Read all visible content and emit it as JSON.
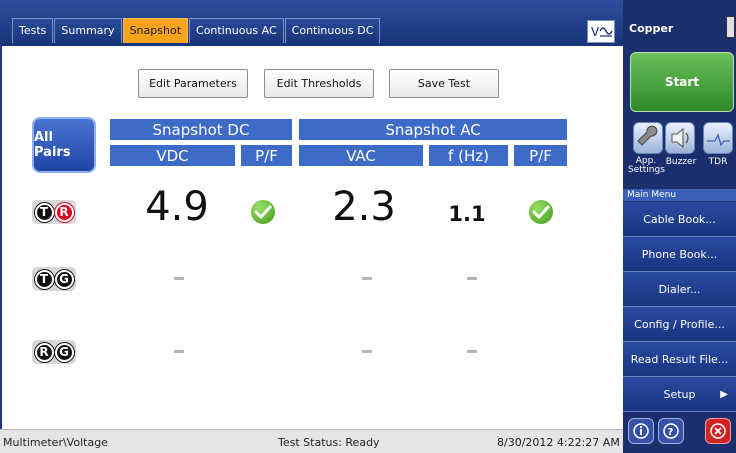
{
  "tabs": [
    {
      "label": "Tests"
    },
    {
      "label": "Summary"
    },
    {
      "label": "Snapshot",
      "active": true
    },
    {
      "label": "Continuous AC"
    },
    {
      "label": "Continuous DC"
    }
  ],
  "toolbar": {
    "edit_parameters": "Edit Parameters",
    "edit_thresholds": "Edit Thresholds",
    "save_test": "Save Test"
  },
  "all_pairs_label": "All Pairs",
  "headers": {
    "snapshot_dc": "Snapshot DC",
    "snapshot_ac": "Snapshot AC",
    "vdc": "VDC",
    "pf_dc": "P/F",
    "vac": "VAC",
    "fhz": "f (Hz)",
    "pf_ac": "P/F"
  },
  "rows": [
    {
      "pair": [
        "T",
        "R"
      ],
      "vdc": "4.9",
      "vac": "2.3",
      "fhz": "1.1",
      "dc_pass": true,
      "ac_pass": true
    },
    {
      "pair": [
        "T",
        "G"
      ],
      "vdc": "–",
      "vac": "–",
      "fhz": "–"
    },
    {
      "pair": [
        "R",
        "G"
      ],
      "vdc": "–",
      "vac": "–",
      "fhz": "–"
    }
  ],
  "status": {
    "path": "Multimeter\\Voltage",
    "test_status": "Test Status: Ready",
    "datetime": "8/30/2012 4:22:27 AM"
  },
  "side": {
    "title": "Copper",
    "start": "Start",
    "tools": [
      {
        "label": "App. Settings",
        "icon": "wrench-icon"
      },
      {
        "label": "Buzzer",
        "icon": "speaker-icon"
      },
      {
        "label": "TDR",
        "icon": "tdr-icon"
      }
    ],
    "main_menu_title": "Main Menu",
    "menu": [
      {
        "label": "Cable Book..."
      },
      {
        "label": "Phone Book..."
      },
      {
        "label": "Dialer..."
      },
      {
        "label": "Config / Profile..."
      },
      {
        "label": "Read Result File..."
      },
      {
        "label": "Setup"
      }
    ]
  },
  "colors": {
    "header_blue": "#3d6bc7",
    "active_tab": "#f7a41c",
    "start_green": "#3c9a32",
    "sidebar": "#1b2f6e"
  }
}
